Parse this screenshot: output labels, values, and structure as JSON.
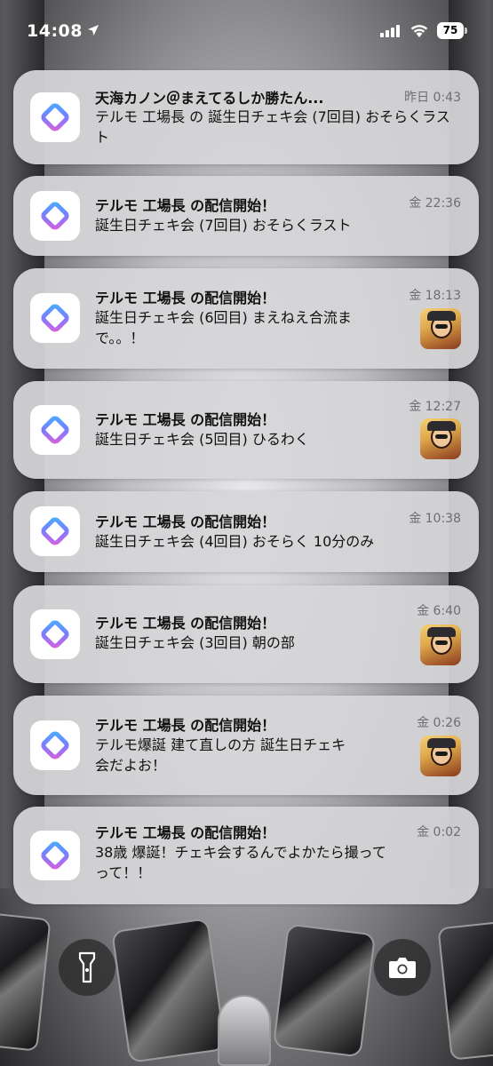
{
  "status_bar": {
    "time": "14:08",
    "battery": "75"
  },
  "notifications": [
    {
      "title": "天海カノン＠まえてるしか勝たん...",
      "body": "テルモ 工場長 の 誕生日チェキ会 (7回目) おそらくラスト",
      "time": "昨日 0:43",
      "has_thumbnail": false
    },
    {
      "title": "テルモ 工場長 の配信開始！",
      "body": "誕生日チェキ会 (7回目) おそらくラスト",
      "time": "金 22:36",
      "has_thumbnail": false
    },
    {
      "title": "テルモ 工場長 の配信開始！",
      "body": "誕生日チェキ会 (6回目) まえねえ合流まで。。！",
      "time": "金 18:13",
      "has_thumbnail": true
    },
    {
      "title": "テルモ 工場長 の配信開始！",
      "body": "誕生日チェキ会 (5回目) ひるわく",
      "time": "金 12:27",
      "has_thumbnail": true
    },
    {
      "title": "テルモ 工場長 の配信開始！",
      "body": "誕生日チェキ会 (4回目) おそらく 10分のみ",
      "time": "金 10:38",
      "has_thumbnail": false
    },
    {
      "title": "テルモ 工場長 の配信開始！",
      "body": "誕生日チェキ会 (3回目) 朝の部",
      "time": "金 6:40",
      "has_thumbnail": true
    },
    {
      "title": "テルモ 工場長 の配信開始！",
      "body": "テルモ爆誕 建て直しの方 誕生日チェキ会だよお！",
      "time": "金 0:26",
      "has_thumbnail": true
    },
    {
      "title": "テルモ 工場長 の配信開始！",
      "body": "38歳 爆誕！チェキ会するんでよかたら撮ってって！！",
      "time": "金 0:02",
      "has_thumbnail": false
    }
  ],
  "icons": {
    "app": "app-diamond-icon",
    "flashlight": "flashlight-icon",
    "camera": "camera-icon"
  },
  "colors": {
    "card_bg": "#d6d6d8",
    "app_icon_gradient_start": "#3fb6ff",
    "app_icon_gradient_end": "#e95bd6"
  }
}
